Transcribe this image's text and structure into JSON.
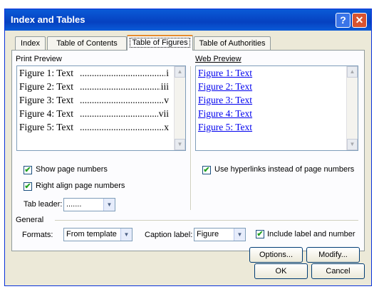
{
  "window": {
    "title": "Index and Tables"
  },
  "tabs": [
    {
      "label": "Index"
    },
    {
      "label": "Table of Contents"
    },
    {
      "label": "Table of Figures"
    },
    {
      "label": "Table of Authorities"
    }
  ],
  "print_preview": {
    "label": "Print Preview",
    "entries": [
      {
        "text": "Figure 1: Text",
        "page": "i"
      },
      {
        "text": "Figure 2: Text",
        "page": "iii"
      },
      {
        "text": "Figure 3: Text",
        "page": "v"
      },
      {
        "text": "Figure 4: Text",
        "page": "vii"
      },
      {
        "text": "Figure 5: Text",
        "page": "x"
      }
    ]
  },
  "web_preview": {
    "label": "Web Preview",
    "entries": [
      "Figure 1: Text",
      "Figure 2: Text",
      "Figure 3: Text",
      "Figure 4: Text",
      "Figure 5: Text"
    ]
  },
  "options": {
    "show_page_numbers": {
      "label": "Show page numbers",
      "checked": true
    },
    "right_align": {
      "label": "Right align page numbers",
      "checked": true
    },
    "use_hyperlinks": {
      "label": "Use hyperlinks instead of page numbers",
      "checked": true
    },
    "include_label": {
      "label": "Include label and number",
      "checked": true
    }
  },
  "tab_leader": {
    "label": "Tab leader:",
    "value": "......."
  },
  "general": {
    "label": "General",
    "formats_label": "Formats:",
    "formats_value": "From template",
    "caption_label": "Caption label:",
    "caption_value": "Figure"
  },
  "buttons": {
    "options": "Options...",
    "modify": "Modify...",
    "ok": "OK",
    "cancel": "Cancel"
  },
  "icons": {
    "help": "?",
    "close": "✕",
    "check": "✔",
    "arrow_up": "▲",
    "arrow_down": "▼"
  }
}
